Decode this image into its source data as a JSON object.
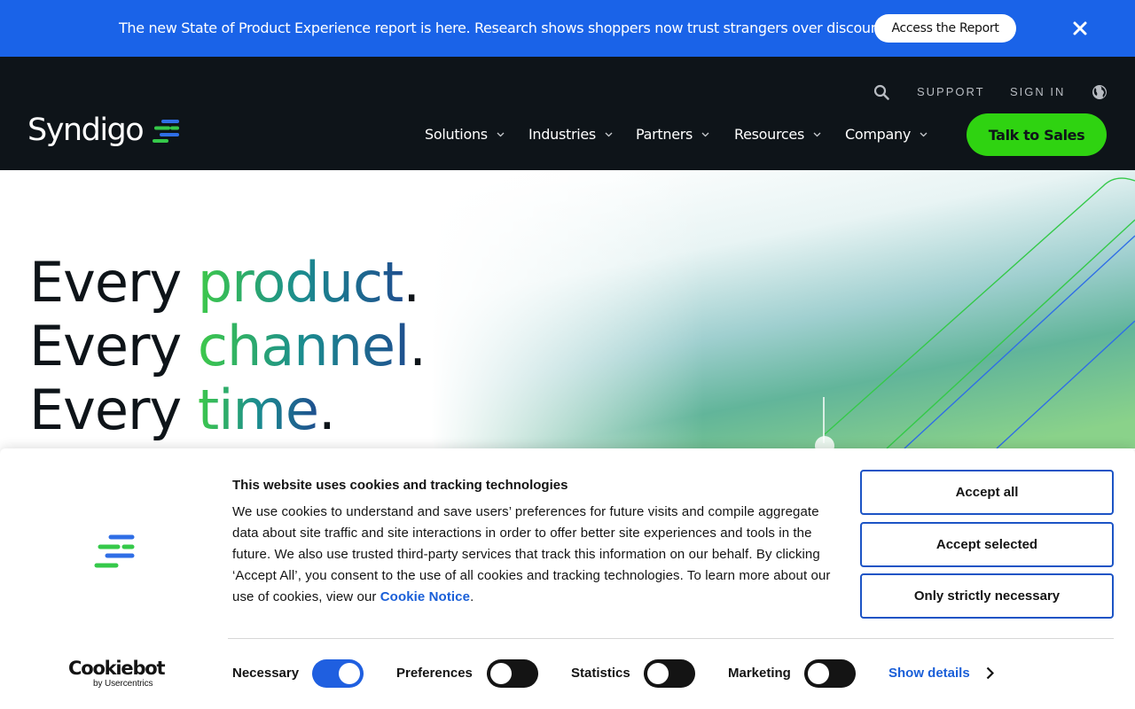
{
  "announcement": {
    "text": "The new State of Product Experience report is here. Research shows shoppers now trust strangers over discounts.",
    "cta_label": "Access the Report",
    "close_icon": "close-icon"
  },
  "header": {
    "logo_text": "Syndigo",
    "utility": {
      "search_icon": "search-icon",
      "support_label": "SUPPORT",
      "signin_label": "SIGN IN",
      "language_icon": "globe-icon"
    },
    "nav": [
      {
        "label": "Solutions"
      },
      {
        "label": "Industries"
      },
      {
        "label": "Partners"
      },
      {
        "label": "Resources"
      },
      {
        "label": "Company"
      }
    ],
    "cta_label": "Talk to Sales",
    "colors": {
      "background": "#0e1419",
      "cta": "#2fd311"
    }
  },
  "hero": {
    "lines": [
      {
        "prefix": "Every ",
        "highlight": "product",
        "suffix": "."
      },
      {
        "prefix": "Every ",
        "highlight": "channel",
        "suffix": "."
      },
      {
        "prefix": "Every ",
        "highlight": "time",
        "suffix": "."
      }
    ]
  },
  "cookie_banner": {
    "title": "This website uses cookies and tracking technologies",
    "body": "We use cookies to understand and save users’ preferences for future visits and compile aggregate data about site traffic and site interactions in order to offer better site experiences and tools in the future. We also use trusted third-party services that track this information on our behalf. By clicking ‘Accept All’, you consent to the use of all cookies and tracking technologies. To learn more about our use of cookies, view our ",
    "link_label": "Cookie Notice",
    "body_end": ".",
    "buttons": {
      "accept_all": "Accept all",
      "accept_selected": "Accept selected",
      "strictly_necessary": "Only strictly necessary"
    },
    "brand": {
      "name": "Cookiebot",
      "sub": "by Usercentrics"
    },
    "toggles": [
      {
        "label": "Necessary",
        "on": true
      },
      {
        "label": "Preferences",
        "on": false
      },
      {
        "label": "Statistics",
        "on": false
      },
      {
        "label": "Marketing",
        "on": false
      }
    ],
    "show_details_label": "Show details",
    "colors": {
      "accent": "#1f5fe0",
      "link": "#1a5fd8"
    }
  }
}
